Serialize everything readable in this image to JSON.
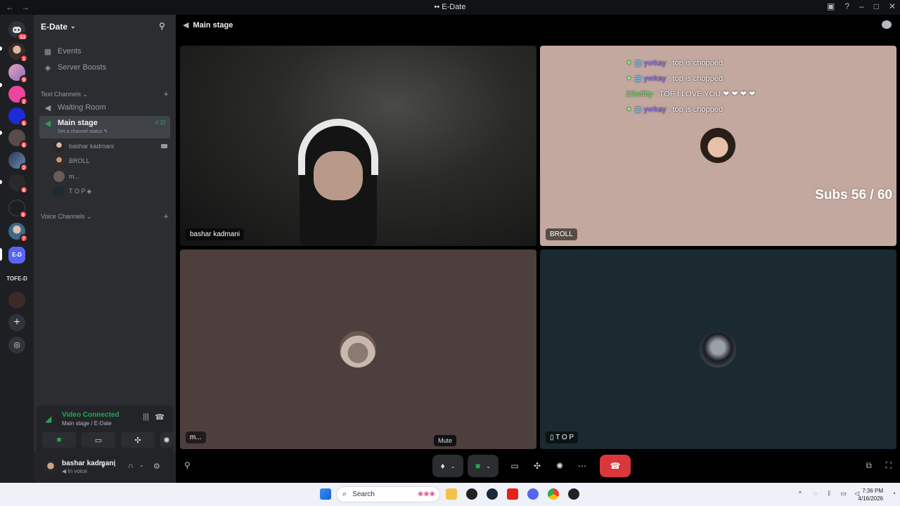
{
  "window": {
    "title": "E-Date"
  },
  "guilds": {
    "badges": [
      "33",
      "1",
      "9",
      "2",
      "6",
      "6",
      "2",
      "6",
      "8",
      "7"
    ],
    "folder_label": "TOFE-D",
    "current_label": "E-D"
  },
  "server": {
    "name": "E-Date",
    "items": [
      "Events",
      "Server Boosts"
    ],
    "text_category": "Text Channels",
    "channels": {
      "waiting": "Waiting Room",
      "main": "Main stage",
      "main_status": "Set a channel status",
      "main_time": "4:32"
    },
    "voice_users": [
      "bashar kadmani",
      "BROLL",
      "m...",
      "T O P"
    ],
    "voice_category": "Voice Channels"
  },
  "voice_status": {
    "status": "Video Connected",
    "sub": "Main stage / E-Date"
  },
  "user_panel": {
    "name": "bashar kadmani",
    "status": "In voice"
  },
  "stage": {
    "header": "Main stage",
    "tiles": [
      {
        "name": "bashar kadmani"
      },
      {
        "name": "BROLL"
      },
      {
        "name": "m..."
      },
      {
        "name": "T O P"
      }
    ],
    "overlay": {
      "lines": [
        {
          "user": "yvrkay",
          "sep": ":",
          "text": "top is chopped"
        },
        {
          "user": "yvrkay",
          "sep": ":",
          "text": "top is chopped"
        },
        {
          "user": "2Swiftty",
          "sep": ":",
          "text": "TOP I LOVE YOU ❤ ❤ ❤ ❤"
        },
        {
          "user": "yvrkay",
          "sep": ":",
          "text": "top is chopped"
        }
      ],
      "subs": "Subs 56 / 60"
    },
    "tooltip": "Mute"
  },
  "taskbar": {
    "search_placeholder": "Search",
    "time": "7:36 PM",
    "date": "4/16/2026"
  },
  "colors": {
    "accent": "#5865f2",
    "green": "#23a559",
    "end_call": "#da373c",
    "tile_brown": "#4d3f3d",
    "tile_teal": "#1a2a30",
    "tile_beige": "#c3a8a0"
  }
}
